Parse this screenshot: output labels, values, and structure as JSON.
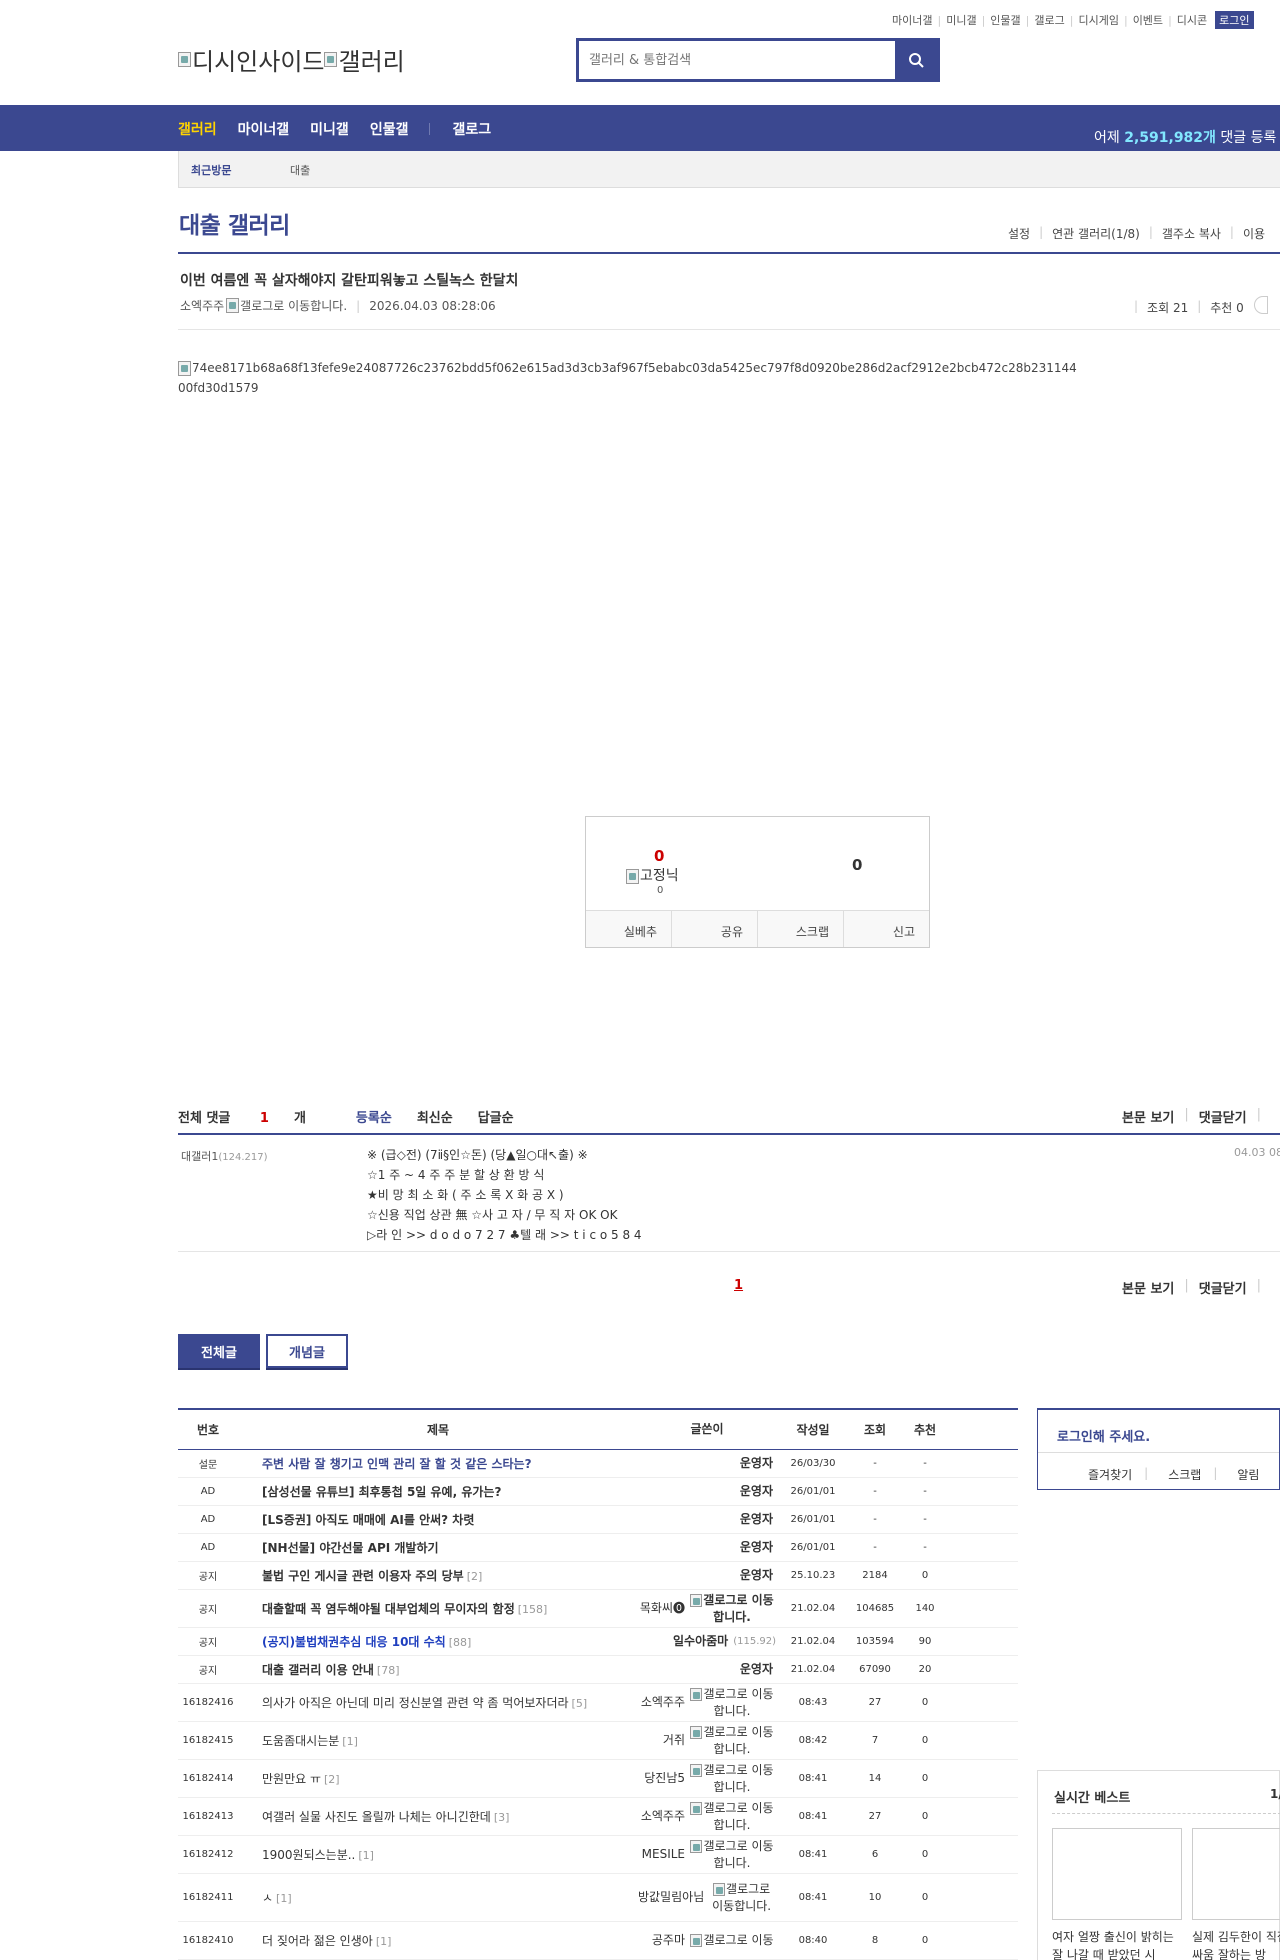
{
  "util_links": [
    "마이너갤",
    "미니갤",
    "인물갤",
    "갤로그",
    "디시게임",
    "이벤트",
    "디시콘"
  ],
  "login_label": "로그인",
  "logo": {
    "alt1": "디시인사이드",
    "alt2": "갤러리"
  },
  "search": {
    "placeholder": "갤러리 & 통합검색"
  },
  "nav": {
    "items": [
      "갤러리",
      "마이너갤",
      "미니갤",
      "인물갤",
      "갤로그"
    ],
    "stat_prefix": "어제 ",
    "stat_value": "2,591,982개",
    "stat_suffix": " 댓글 등록"
  },
  "recent": {
    "label": "최근방문",
    "item": "대출"
  },
  "gallery": {
    "title": "대출 갤러리",
    "options": [
      "설정",
      "연관 갤러리(1/8)",
      "갤주소 복사",
      "이용"
    ]
  },
  "post": {
    "title": "이번 여름엔 꼭 살자해야지 갈탄피워놓고 스틸녹스 한달치",
    "author": "소엑주주",
    "author_note": "갤로그로 이동합니다.",
    "date": "2026.04.03 08:28:06",
    "views": "조회 21",
    "recommend": "추천 0",
    "image_alt": "74ee8171b68a68f13fefe9e24087726c23762bdd5f062e615ad3d3cb3af967f5ebabc03da5425ec797f8d0920be286d2acf2912e2bcb472c28b23114400fd30d1579"
  },
  "recommend_box": {
    "up": "0",
    "fixed_label": "고정닉",
    "fixed_count": "0",
    "down": "0",
    "actions": [
      "실베추",
      "공유",
      "스크랩",
      "신고"
    ]
  },
  "comments": {
    "total_label": "전체 댓글 ",
    "total_count": "1",
    "total_suffix": "개",
    "sorts": [
      "등록순",
      "최신순",
      "답글순"
    ],
    "right_actions": [
      "본문 보기",
      "댓글닫기"
    ],
    "items": [
      {
        "user": "대갤러1",
        "ip": "(124.217)",
        "date": "04.03 08",
        "lines": [
          "※ (급◇전) (7ⅱ§인☆돈) (당▲일○대↖출) ※",
          "☆1 주 ~ 4 주 주 분 할 상 환 방 식",
          "★비 망 최 소 화 ( 주 소 록 X 화 공 X )",
          "☆신용 직업 상관 無 ☆사 고 자 / 무 직 자 OK OK",
          "▷라 인 >> d o d o 7 2 7 ♣텔 래 >> t i c o 5 8 4"
        ]
      }
    ],
    "page": "1"
  },
  "board_tabs": [
    "전체글",
    "개념글"
  ],
  "list": {
    "headers": [
      "번호",
      "제목",
      "글쓴이",
      "작성일",
      "조회",
      "추천"
    ],
    "rows": [
      {
        "num": "설문",
        "title": "주변 사람 잘 챙기고 인맥 관리 잘 할 것 같은 스타는?",
        "reply": "",
        "writer": "운영자",
        "note": "",
        "ip": "",
        "date": "26/03/30",
        "views": "-",
        "rec": "-",
        "style": "blue"
      },
      {
        "num": "AD",
        "title": "[삼성선물 유튜브] 최후통첩 5일 유예, 유가는?",
        "reply": "",
        "writer": "운영자",
        "note": "",
        "ip": "",
        "date": "26/01/01",
        "views": "-",
        "rec": "-",
        "style": "strong"
      },
      {
        "num": "AD",
        "title": "[LS증권] 아직도 매매에 AI를 안써? 차렷",
        "reply": "",
        "writer": "운영자",
        "note": "",
        "ip": "",
        "date": "26/01/01",
        "views": "-",
        "rec": "-",
        "style": "strong"
      },
      {
        "num": "AD",
        "title": "[NH선물] 야간선물 API 개발하기",
        "reply": "",
        "writer": "운영자",
        "note": "",
        "ip": "",
        "date": "26/01/01",
        "views": "-",
        "rec": "-",
        "style": "strong"
      },
      {
        "num": "공지",
        "title": "불법 구인 게시글 관련 이용자 주의 당부",
        "reply": "[2]",
        "writer": "운영자",
        "note": "",
        "ip": "",
        "date": "25.10.23",
        "views": "2184",
        "rec": "0",
        "style": "strong"
      },
      {
        "num": "공지",
        "title": "대출할때 꼭 염두해야될 대부업체의 무이자의 함정",
        "reply": "[158]",
        "writer": "목화씨⓿",
        "note": "갤로그로 이동합니다.",
        "ip": "",
        "date": "21.02.04",
        "views": "104685",
        "rec": "140",
        "style": "strong",
        "bold_note": true
      },
      {
        "num": "공지",
        "title": "(공지)불법채권추심 대응 10대 수칙",
        "reply": "[88]",
        "writer": "일수아줌마",
        "note": "",
        "ip": "(115.92)",
        "date": "21.02.04",
        "views": "103594",
        "rec": "90",
        "style": "ltblue"
      },
      {
        "num": "공지",
        "title": "대출 갤러리 이용 안내",
        "reply": "[78]",
        "writer": "운영자",
        "note": "",
        "ip": "",
        "date": "21.02.04",
        "views": "67090",
        "rec": "20",
        "style": "strong"
      },
      {
        "num": "16182416",
        "title": "의사가 아직은 아닌데 미리 정신분열 관련 약 좀 먹어보자더라",
        "reply": "[5]",
        "writer": "소엑주주",
        "note": "갤로그로 이동합니다.",
        "ip": "",
        "date": "08:43",
        "views": "27",
        "rec": "0",
        "style": ""
      },
      {
        "num": "16182415",
        "title": "도움좀대시는분",
        "reply": "[1]",
        "writer": "거쥐",
        "note": "갤로그로 이동합니다.",
        "ip": "",
        "date": "08:42",
        "views": "7",
        "rec": "0",
        "style": ""
      },
      {
        "num": "16182414",
        "title": "만원만요 ㅠ",
        "reply": "[2]",
        "writer": "당진남5",
        "note": "갤로그로 이동합니다.",
        "ip": "",
        "date": "08:41",
        "views": "14",
        "rec": "0",
        "style": ""
      },
      {
        "num": "16182413",
        "title": "여갤러 실물 사진도 올릴까 나체는 아니긴한데",
        "reply": "[3]",
        "writer": "소엑주주",
        "note": "갤로그로 이동합니다.",
        "ip": "",
        "date": "08:41",
        "views": "27",
        "rec": "0",
        "style": ""
      },
      {
        "num": "16182412",
        "title": "1900원되스는분..",
        "reply": "[1]",
        "writer": "MESILE",
        "note": "갤로그로 이동합니다.",
        "ip": "",
        "date": "08:41",
        "views": "6",
        "rec": "0",
        "style": ""
      },
      {
        "num": "16182411",
        "title": "ㅅ",
        "reply": "[1]",
        "writer": "방값밀림아님",
        "note": "갤로그로 이동합니다.",
        "ip": "",
        "date": "08:41",
        "views": "10",
        "rec": "0",
        "style": ""
      },
      {
        "num": "16182410",
        "title": "더 짖어라 젊은 인생아",
        "reply": "[1]",
        "writer": "공주마",
        "note": "갤로그로 이동",
        "ip": "",
        "date": "08:40",
        "views": "8",
        "rec": "0",
        "style": ""
      }
    ]
  },
  "side": {
    "login_prompt": "로그인해 주세요.",
    "login_actions": [
      "즐겨찾기",
      "스크랩",
      "알림"
    ],
    "best_title": "실시간 베스트",
    "best_page": "1/",
    "best_caps": [
      "여자 얼짱 출신이 밝히는 잘 나갈 때 받았던 시",
      "실제 김두한이 직접 밝히는 싸움 잘하는 방"
    ]
  }
}
